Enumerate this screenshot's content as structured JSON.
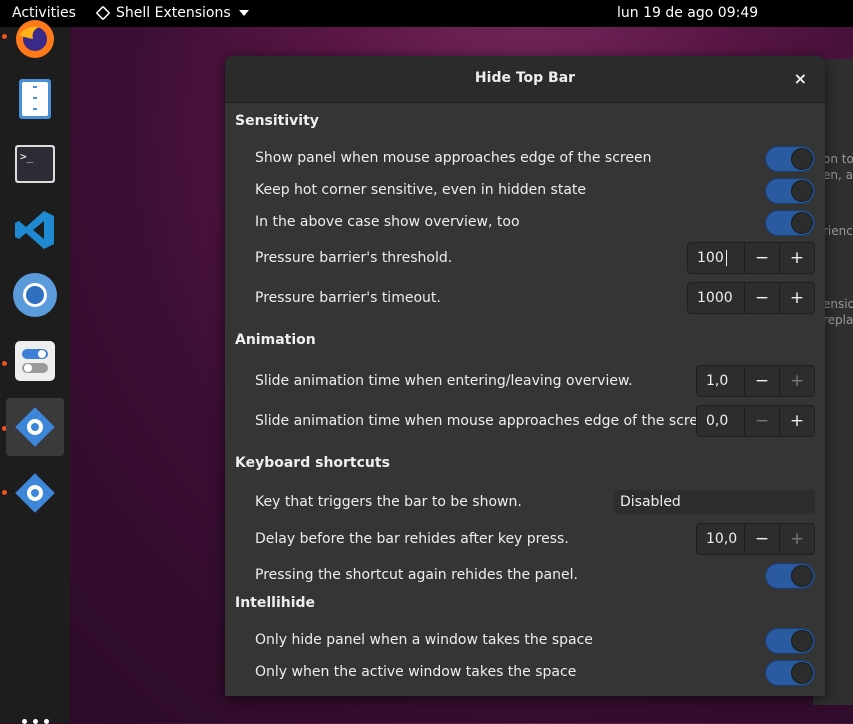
{
  "topbar": {
    "activities": "Activities",
    "app_menu": "Shell Extensions",
    "clock": "lun 19 de ago  09:49"
  },
  "dock": {
    "apps": [
      {
        "icon": "firefox-icon",
        "running": true
      },
      {
        "icon": "files-icon",
        "running": false
      },
      {
        "icon": "terminal-icon",
        "running": false
      },
      {
        "icon": "vscode-icon",
        "running": false
      },
      {
        "icon": "chromium-icon",
        "running": false
      },
      {
        "icon": "tweaks-icon",
        "running": true
      },
      {
        "icon": "extensions-icon",
        "running": true,
        "active": true
      },
      {
        "icon": "extensions-icon",
        "running": true
      }
    ]
  },
  "background_window": {
    "fragments": [
      "on to",
      "en, an",
      "rienc",
      "ensio",
      "replac"
    ]
  },
  "dialog": {
    "title": "Hide Top Bar",
    "close": "×",
    "sections": {
      "sensitivity": "Sensitivity",
      "animation": "Animation",
      "keyboard": "Keyboard shortcuts",
      "intellihide": "Intellihide"
    },
    "settings": {
      "show_panel_mouse": {
        "label": "Show panel when mouse approaches edge of the screen",
        "enabled": true
      },
      "hot_corner": {
        "label": "Keep hot corner sensitive, even in hidden state",
        "enabled": true
      },
      "show_overview": {
        "label": "In the above case show overview, too",
        "enabled": true
      },
      "pressure_threshold": {
        "label": "Pressure barrier's threshold.",
        "value": "100"
      },
      "pressure_timeout": {
        "label": "Pressure barrier's timeout.",
        "value": "1000"
      },
      "anim_overview": {
        "label": "Slide animation time when entering/leaving overview.",
        "value": "1,0"
      },
      "anim_mouse": {
        "label": "Slide animation time when mouse approaches edge of the screen.",
        "value": "0,0"
      },
      "trigger_key": {
        "label": "Key that triggers the bar to be shown.",
        "value": "Disabled"
      },
      "rehide_delay": {
        "label": "Delay before the bar rehides after key press.",
        "value": "10,0"
      },
      "shortcut_rehides": {
        "label": "Pressing the shortcut again rehides the panel.",
        "enabled": true
      },
      "hide_window_space": {
        "label": "Only hide panel when a window takes the space",
        "enabled": true
      },
      "active_window_space": {
        "label": "Only when the active window takes the space",
        "enabled": true
      }
    },
    "minus": "−",
    "plus": "+"
  },
  "colors": {
    "switch_on": "#2a5aa0",
    "running_dot": "#e95420",
    "dialog_bg": "#353535"
  }
}
